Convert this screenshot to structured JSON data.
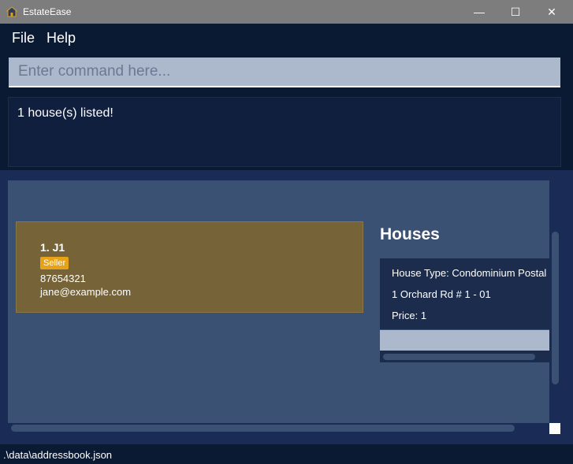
{
  "window": {
    "title": "EstateEase",
    "icon": "house-icon",
    "minimize_glyph": "—",
    "maximize_glyph": "☐",
    "close_glyph": "✕"
  },
  "menu": {
    "file": "File",
    "help": "Help"
  },
  "command": {
    "placeholder": "Enter command here...",
    "value": ""
  },
  "result": {
    "message": "1 house(s) listed!"
  },
  "person": {
    "name": "1.  J1",
    "tag": "Seller",
    "phone": "87654321",
    "email": "jane@example.com"
  },
  "houses": {
    "title": "Houses",
    "items": [
      {
        "type": "House Type: Condominium   Postal",
        "address": "1 Orchard Rd # 1 - 01",
        "price": "Price: 1"
      }
    ]
  },
  "status": {
    "path": ".\\data\\addressbook.json"
  },
  "colors": {
    "titlebar": "#7d7d7d",
    "background": "#0b1a33",
    "panel": "#3b5173",
    "card": "#766337",
    "tag": "#e6a31a",
    "input": "#acb8cc"
  }
}
